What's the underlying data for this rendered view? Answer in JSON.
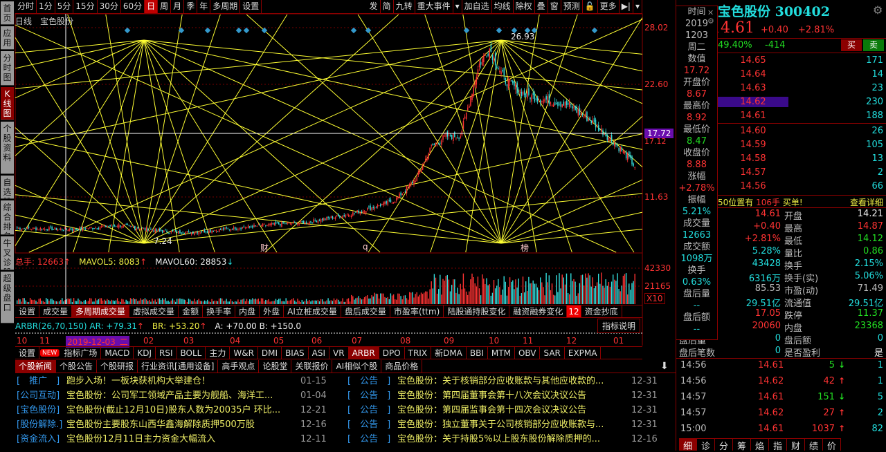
{
  "sidebar": [
    "首页",
    "应用",
    "分时图",
    "K线图",
    "个股资料",
    "自选股",
    "综合排名",
    "牛叉诊股",
    "超级盘口"
  ],
  "toolbar_left": [
    "分时",
    "1分",
    "5分",
    "15分",
    "30分",
    "60分",
    "日",
    "周",
    "月",
    "季",
    "年",
    "多周期",
    "设置"
  ],
  "toolbar_right": [
    "发",
    "简",
    "九转",
    "重大事件",
    "▾",
    "加自选",
    "均线",
    "除权",
    "叠",
    "窗",
    "预测",
    "🔓",
    "更多",
    "▶|",
    "▾"
  ],
  "chart": {
    "title": "日线",
    "name": "宝色股份",
    "axis": [
      "28.02",
      "22.60",
      "17.72",
      "17.12",
      "11.63"
    ],
    "high_label": "26.93",
    "low_label": "7.24",
    "markers": [
      "财",
      "q",
      "榜"
    ]
  },
  "kline": {
    "anchors": [
      [
        0,
        8.6
      ],
      [
        40,
        8.5
      ],
      [
        70,
        8.9
      ],
      [
        100,
        8.3
      ],
      [
        120,
        8.2
      ],
      [
        150,
        8.6
      ],
      [
        170,
        8.9
      ],
      [
        200,
        9.2
      ],
      [
        230,
        10.0
      ],
      [
        260,
        11.3
      ],
      [
        275,
        13.5
      ],
      [
        285,
        16.5
      ],
      [
        295,
        17.5
      ],
      [
        305,
        17.6
      ],
      [
        318,
        24.5
      ],
      [
        325,
        26.0
      ],
      [
        335,
        23
      ],
      [
        350,
        21.5
      ],
      [
        365,
        21
      ],
      [
        380,
        20.5
      ],
      [
        395,
        19
      ],
      [
        410,
        17
      ],
      [
        420,
        15.5
      ],
      [
        425,
        14.6
      ]
    ]
  },
  "volume": {
    "label": "总手: 12663",
    "mavol5": "MAVOL5: 8083",
    "mavol60": "MAVOL60: 28853",
    "axis": [
      "42330",
      "21165",
      "X10"
    ]
  },
  "vol_tabs": [
    "设置",
    "成交量",
    "多周期成交量",
    "虚拟成交量",
    "金额",
    "换手率",
    "内盘",
    "外盘",
    "AI立桩成交量",
    "盘后成交量",
    "市盈率(ttm)",
    "陆股通持股变化",
    "融资融券变化",
    "12",
    "资金抄底"
  ],
  "arbr": {
    "name": "ARBR(26,70,150)",
    "ar": "AR: +79.31",
    "br": "BR: +53.20",
    "a": "A: +70.00",
    "b": "B: +150.0",
    "help": "指标说明"
  },
  "dates": [
    "10",
    "11",
    "2019-12-03_二",
    "02",
    "03",
    "04",
    "05",
    "06",
    "07",
    "08",
    "09",
    "10",
    "11",
    "12",
    "01"
  ],
  "ind_tabs": [
    "设置",
    "NEW",
    "指标广场",
    "MACD",
    "KDJ",
    "RSI",
    "BOLL",
    "主力",
    "W&R",
    "DMI",
    "BIAS",
    "ASI",
    "VR",
    "ARBR",
    "DPO",
    "TRIX",
    "新DMA",
    "BBI",
    "MTM",
    "OBV",
    "SAR",
    "EXPMA"
  ],
  "news_tabs": [
    "个股新闻",
    "个股公告",
    "个股研报",
    "行业资讯[通用设备]",
    "高手观点",
    "论股堂",
    "关联报价",
    "AI相似个股",
    "商品价格"
  ],
  "news_left": [
    {
      "tag": "[　推广　]",
      "title": "跑步入场！一板块获机构大举建仓！",
      "date": "01-15"
    },
    {
      "tag": "[公司互动]",
      "title": "宝色股份：公司军工领域产品主要为舰船、海洋工...",
      "date": "01-04"
    },
    {
      "tag": "[宝色股份]",
      "title": "宝色股份(截止12月10日)股东人数为20035户 环比...",
      "date": "12-21"
    },
    {
      "tag": "[股份解除.]",
      "title": "宝色股份主要股东山西华鑫海解除质押500万股",
      "date": "12-16"
    },
    {
      "tag": "[资金流入]",
      "title": "宝色股份12月11日主力资金大幅流入",
      "date": "12-11"
    }
  ],
  "news_right": [
    {
      "tag": "[　公告　]",
      "title": "宝色股份：关于核销部分应收账款与其他应收款的...",
      "date": "12-31"
    },
    {
      "tag": "[　公告　]",
      "title": "宝色股份：第四届董事会第十八次会议决议公告",
      "date": "12-31"
    },
    {
      "tag": "[　公告　]",
      "title": "宝色股份：第四届监事会第十四次会议决议公告",
      "date": "12-31"
    },
    {
      "tag": "[　公告　]",
      "title": "宝色股份：独立董事关于公司核销部分应收账款与...",
      "date": "12-31"
    },
    {
      "tag": "[　公告　]",
      "title": "宝色股份：关于持股5%以上股东股份解除质押的...",
      "date": "12-16"
    }
  ],
  "popup": [
    "时间",
    "2019",
    "1203",
    "周二",
    "数值",
    "17.72",
    "开盘价",
    "8.67",
    "最高价",
    "8.92",
    "最低价",
    "8.47",
    "收盘价",
    "8.88",
    "涨幅",
    "+2.78%",
    "振幅",
    "5.21%",
    "成交量",
    "12663",
    "成交额",
    "1098万",
    "换手",
    "0.63%",
    "盘后量",
    "--",
    "盘后额",
    "--"
  ],
  "quote": {
    "name": "宝色股份 300402",
    "price": "14.61",
    "change": "+0.40",
    "pct": "+2.81%",
    "ratio": "49.40%",
    "diff": "-414",
    "buy": "买",
    "sell": "卖"
  },
  "orderbook": [
    [
      "14.65",
      "171"
    ],
    [
      "14.64",
      "14"
    ],
    [
      "14.63",
      "23"
    ],
    [
      "14.62",
      "230"
    ],
    [
      "14.61",
      "188"
    ],
    [
      "14.60",
      "26"
    ],
    [
      "14.59",
      "105"
    ],
    [
      "14.58",
      "13"
    ],
    [
      "14.57",
      "2"
    ],
    [
      "14.56",
      "66"
    ]
  ],
  "alert": {
    "prefix": "50位置有",
    "qty": "106手",
    "suffix": "买单!",
    "detail": "查看详细"
  },
  "stats": [
    {
      "lv": "14.61",
      "lab": "开盘",
      "rv": "14.21"
    },
    {
      "lv": "+0.40",
      "lab": "最高",
      "rv": "14.87"
    },
    {
      "lv": "+2.81%",
      "lab": "最低",
      "rv": "14.12"
    },
    {
      "lv": "5.28%",
      "lab": "量比",
      "rv": "0.86"
    },
    {
      "lv": "43428",
      "lab": "换手",
      "rv": "2.15%"
    },
    {
      "lv": "6316万",
      "lab": "换手(实)",
      "rv": "5.06%"
    },
    {
      "lv": "85.53",
      "lab": "市盈(动)",
      "rv": "71.49"
    },
    {
      "lv": "29.51亿",
      "lab": "流通值",
      "rv": "29.51亿"
    },
    {
      "lv": "17.05",
      "lab": "跌停",
      "rv": "11.37"
    },
    {
      "lv": "20060",
      "lab": "内盘",
      "rv": "23368"
    },
    {
      "ll": "盘后量",
      "lv": "0",
      "lab": "盘后额",
      "rv": "0"
    },
    {
      "ll": "盘后笔数",
      "lv": "0",
      "lab": "是否盈利",
      "rv": "是"
    }
  ],
  "ticks": [
    [
      "14:56",
      "14.61",
      "5",
      "1",
      "down"
    ],
    [
      "14:56",
      "14.62",
      "42",
      "1",
      "up"
    ],
    [
      "14:57",
      "14.61",
      "151",
      "5",
      "down"
    ],
    [
      "14:57",
      "14.62",
      "27",
      "2",
      "up"
    ],
    [
      "15:00",
      "14.61",
      "1037",
      "82",
      "up"
    ]
  ],
  "bottom_tabs": [
    "细",
    "诊",
    "分",
    "筹",
    "焰",
    "指",
    "财",
    "绩",
    "价"
  ]
}
